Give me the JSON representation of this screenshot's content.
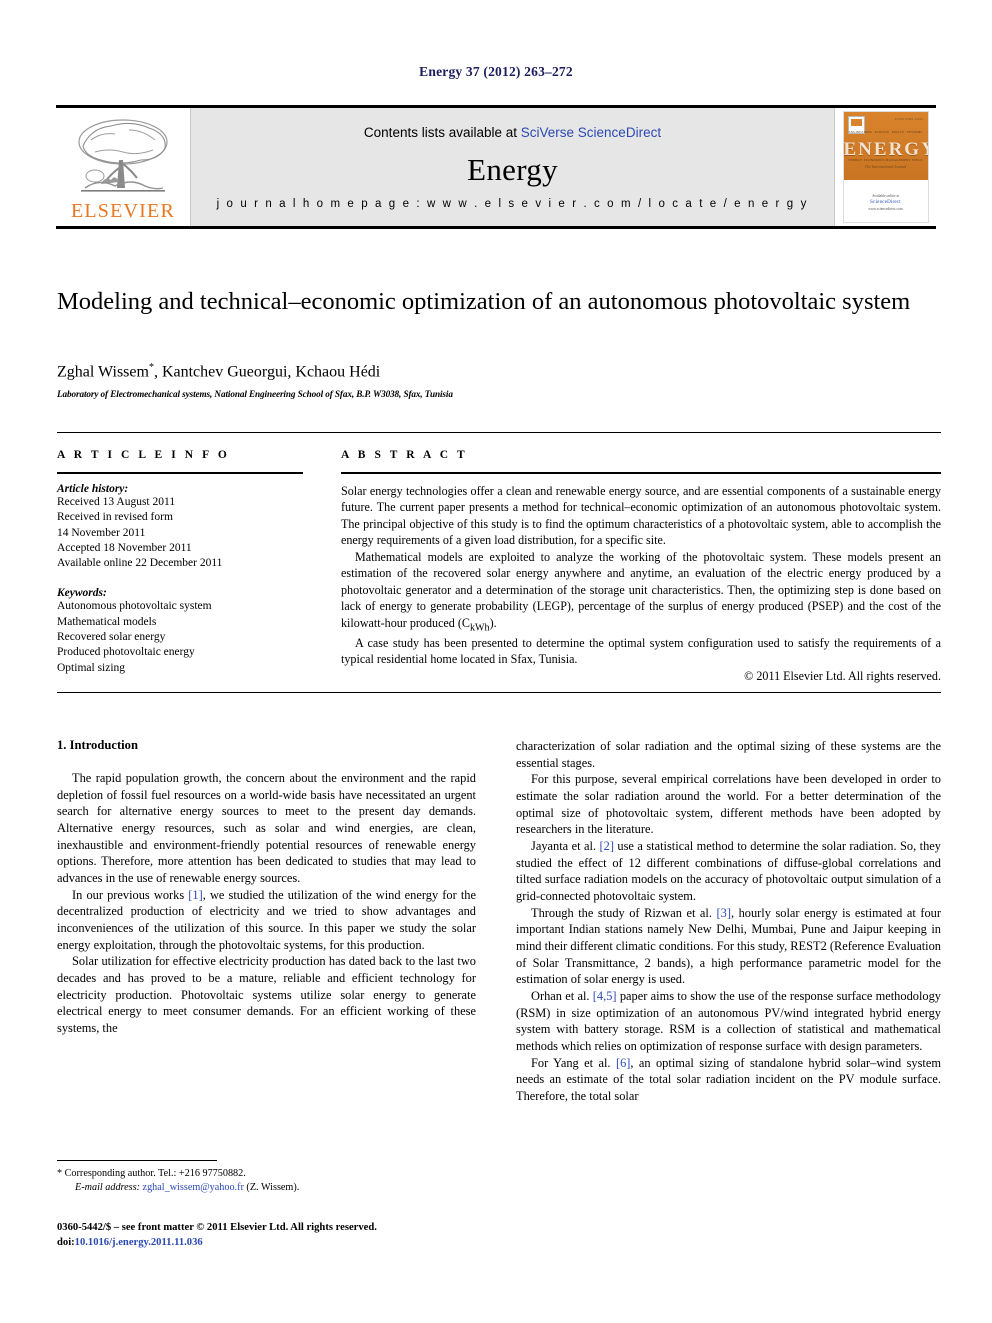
{
  "running_head": "Energy 37 (2012) 263–272",
  "masthead": {
    "publisher_logo_text": "ELSEVIER",
    "contents_prefix": "Contents lists available at ",
    "contents_link": "SciVerse ScienceDirect",
    "journal_name": "Energy",
    "homepage": "j o u r n a l   h o m e p a g e :   w w w . e l s e v i e r . c o m / l o c a t e / e n e r g y",
    "cover": {
      "word": "ENERGY",
      "subtitle": "The International Journal",
      "top_right": "ISSN 0360-5442",
      "mini_labels_top": [
        "ENGINEERING",
        "SCIENCE",
        "POLICY",
        "SYSTEMS"
      ],
      "mini_labels_bottom": [
        "ENERGY",
        "ECONOMICS",
        "MANAGEMENT",
        "FUELS"
      ],
      "available_at": "Available online at",
      "sd_text": "ScienceDirect",
      "sd_url": "www.sciencedirect.com"
    },
    "accent_color": "#E87722",
    "link_color": "#2b49b5"
  },
  "article": {
    "title": "Modeling and technical–economic optimization of an autonomous photovoltaic system",
    "authors": "Zghal Wissem",
    "authors_rest": ", Kantchev Gueorgui, Kchaou Hédi",
    "corresponding_marker": "*",
    "affiliation": "Laboratory of Electromechanical systems, National Engineering School of Sfax, B.P. W3038, Sfax, Tunisia"
  },
  "info": {
    "heading": "A R T I C L E   I N F O",
    "history_label": "Article history:",
    "history": [
      "Received 13 August 2011",
      "Received in revised form",
      "14 November 2011",
      "Accepted 18 November 2011",
      "Available online 22 December 2011"
    ],
    "keywords_label": "Keywords:",
    "keywords": [
      "Autonomous photovoltaic system",
      "Mathematical models",
      "Recovered solar energy",
      "Produced photovoltaic energy",
      "Optimal sizing"
    ]
  },
  "abstract": {
    "heading": "A B S T R A C T",
    "paragraph1": "Solar energy technologies offer a clean and renewable energy source, and are essential components of a sustainable energy future. The current paper presents a method for technical–economic optimization of an autonomous photovoltaic system. The principal objective of this study is to find the optimum characteristics of a photovoltaic system, able to accomplish the energy requirements of a given load distribution, for a specific site.",
    "paragraph2_a": "Mathematical models are exploited to analyze the working of the photovoltaic system. These models present an estimation of the recovered solar energy anywhere and anytime, an evaluation of the electric energy produced by a photovoltaic generator and a determination of the storage unit characteristics. Then, the optimizing step is done based on lack of energy to generate probability (LEGP), percentage of the surplus of energy produced (PSEP) and the cost of the kilowatt-hour produced (C",
    "paragraph2_sub": "kWh",
    "paragraph2_b": ").",
    "paragraph3": "A case study has been presented to determine the optimal system configuration used to satisfy the requirements of a typical residential home located in Sfax, Tunisia.",
    "copyright": "© 2011 Elsevier Ltd. All rights reserved."
  },
  "introduction": {
    "heading": "1. Introduction",
    "left_paragraphs": [
      "The rapid population growth, the concern about the environment and the rapid depletion of fossil fuel resources on a world-wide basis have necessitated an urgent search for alternative energy sources to meet to the present day demands. Alternative energy resources, such as solar and wind energies, are clean, inexhaustible and environment-friendly potential resources of renewable energy options. Therefore, more attention has been dedicated to studies that may lead to advances in the use of renewable energy sources."
    ],
    "left_p2_a": "In our previous works ",
    "left_p2_ref": "[1]",
    "left_p2_b": ", we studied the utilization of the wind energy for the decentralized production of electricity and we tried to show advantages and inconveniences of the utilization of this source. In this paper we study the solar energy exploitation, through the photovoltaic systems, for this production.",
    "left_p3": "Solar utilization for effective electricity production has dated back to the last two decades and has proved to be a mature, reliable and efficient technology for electricity production. Photovoltaic systems utilize solar energy to generate electrical energy to meet consumer demands. For an efficient working of these systems, the",
    "right_p1": "characterization of solar radiation and the optimal sizing of these systems are the essential stages.",
    "right_p2": "For this purpose, several empirical correlations have been developed in order to estimate the solar radiation around the world. For a better determination of the optimal size of photovoltaic system, different methods have been adopted by researchers in the literature.",
    "right_p3_a": "Jayanta et al. ",
    "right_p3_ref": "[2]",
    "right_p3_b": " use a statistical method to determine the solar radiation. So, they studied the effect of 12 different combinations of diffuse-global correlations and tilted surface radiation models on the accuracy of photovoltaic output simulation of a grid-connected photovoltaic system.",
    "right_p4_a": "Through the study of Rizwan et al. ",
    "right_p4_ref": "[3]",
    "right_p4_b": ", hourly solar energy is estimated at four important Indian stations namely New Delhi, Mumbai, Pune and Jaipur keeping in mind their different climatic conditions. For this study, REST2 (Reference Evaluation of Solar Transmittance, 2 bands), a high performance parametric model for the estimation of solar energy is used.",
    "right_p5_a": "Orhan et al. ",
    "right_p5_ref": "[4,5]",
    "right_p5_b": " paper aims to show the use of the response surface methodology (RSM) in size optimization of an autonomous PV/wind integrated hybrid energy system with battery storage. RSM is a collection of statistical and mathematical methods which relies on optimization of response surface with design parameters.",
    "right_p6_a": "For Yang et al. ",
    "right_p6_ref": "[6]",
    "right_p6_b": ", an optimal sizing of standalone hybrid solar–wind system needs an estimate of the total solar radiation incident on the PV module surface. Therefore, the total solar"
  },
  "footer": {
    "corresponding_marker": "*",
    "corresponding_text": "Corresponding author. Tel.: +216 97750882.",
    "email_label": "E-mail address:",
    "email": "zghal_wissem@yahoo.fr",
    "email_suffix": "(Z. Wissem).",
    "imprint_line": "0360-5442/$ – see front matter © 2011 Elsevier Ltd. All rights reserved.",
    "doi_label": "doi:",
    "doi": "10.1016/j.energy.2011.11.036"
  }
}
